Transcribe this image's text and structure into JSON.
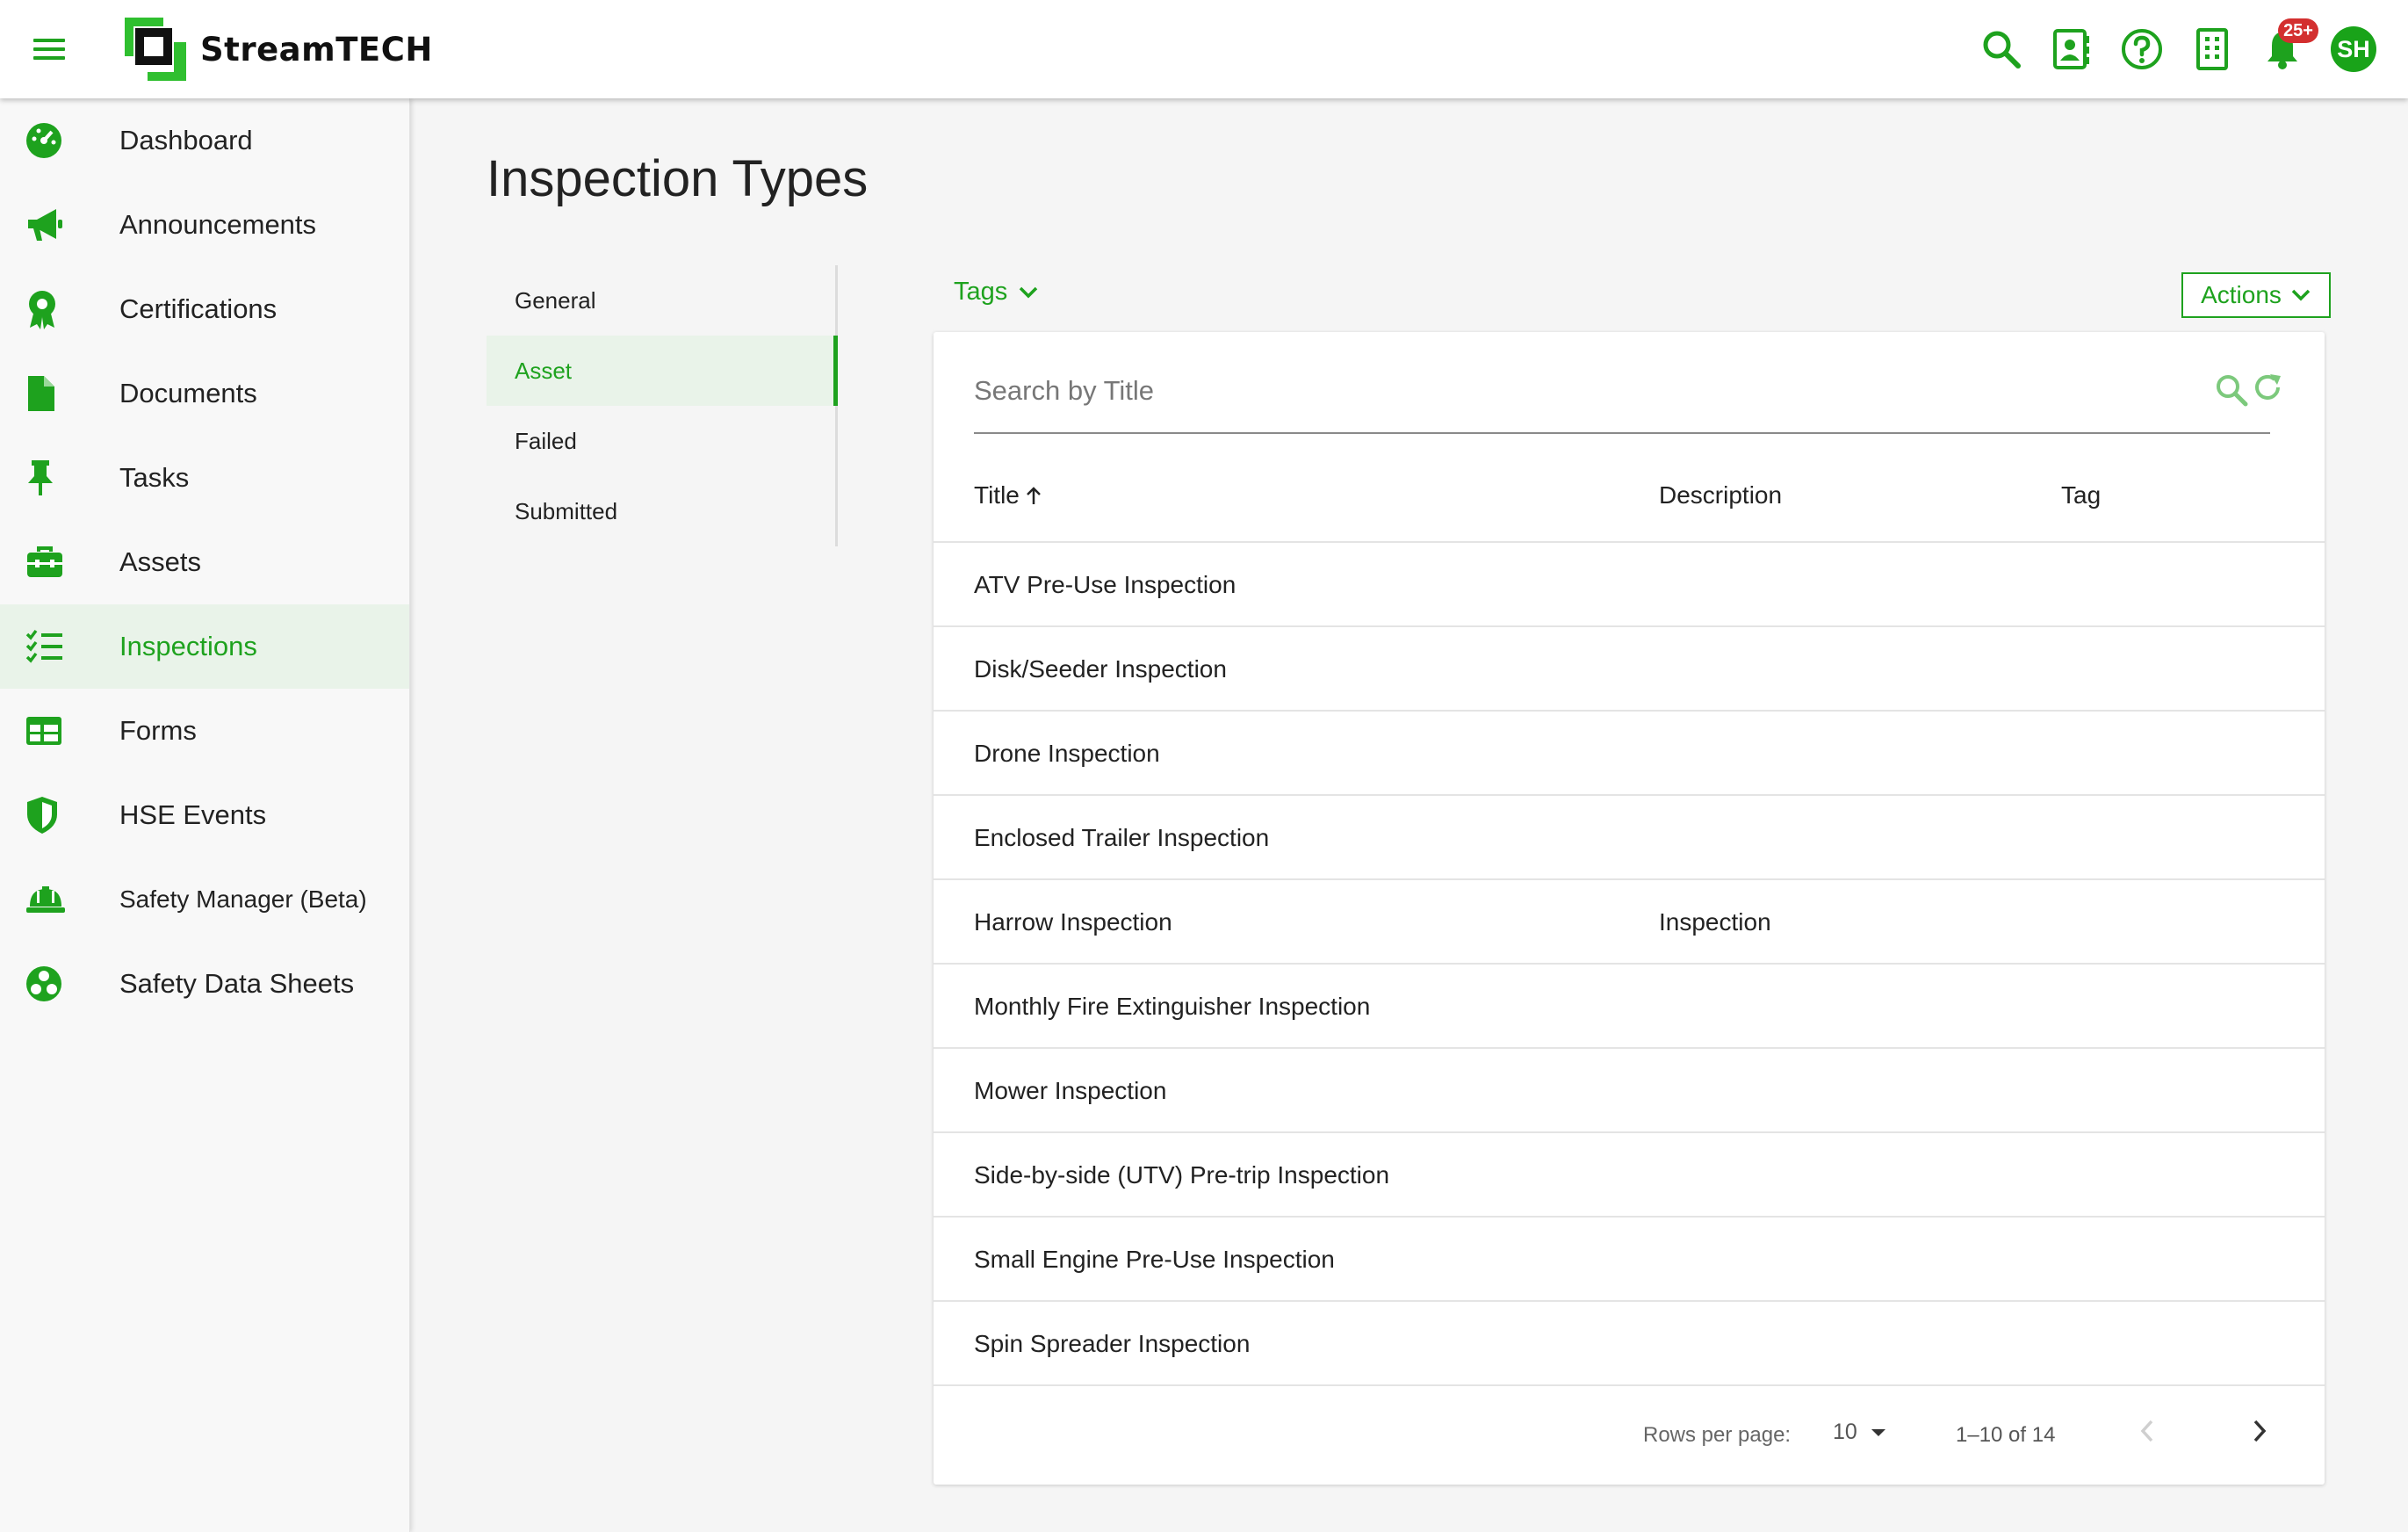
{
  "app": {
    "brand": "StreamTECH",
    "accent": "#1ea21e",
    "avatar_initials": "SH",
    "notification_badge": "25+"
  },
  "topbar_icons": [
    "search-icon",
    "contact-card-icon",
    "help-icon",
    "building-icon",
    "bell-icon"
  ],
  "sidebar": {
    "items": [
      {
        "label": "Dashboard",
        "icon": "dashboard-gauge-icon"
      },
      {
        "label": "Announcements",
        "icon": "megaphone-icon"
      },
      {
        "label": "Certifications",
        "icon": "award-ribbon-icon"
      },
      {
        "label": "Documents",
        "icon": "document-icon"
      },
      {
        "label": "Tasks",
        "icon": "pin-icon"
      },
      {
        "label": "Assets",
        "icon": "toolbox-icon"
      },
      {
        "label": "Inspections",
        "icon": "checklist-icon",
        "active": true
      },
      {
        "label": "Forms",
        "icon": "table-icon"
      },
      {
        "label": "HSE Events",
        "icon": "shield-icon"
      },
      {
        "label": "Safety Manager (Beta)",
        "icon": "hardhat-icon"
      },
      {
        "label": "Safety Data Sheets",
        "icon": "biohazard-icon"
      }
    ]
  },
  "page": {
    "title": "Inspection Types"
  },
  "subnav": {
    "items": [
      {
        "label": "General"
      },
      {
        "label": "Asset",
        "active": true
      },
      {
        "label": "Failed"
      },
      {
        "label": "Submitted"
      }
    ]
  },
  "toolbar": {
    "tags_label": "Tags",
    "actions_label": "Actions"
  },
  "search": {
    "placeholder": "Search by Title",
    "value": ""
  },
  "table": {
    "columns": [
      "Title",
      "Description",
      "Tag"
    ],
    "sort": {
      "column": "Title",
      "direction": "ascending"
    },
    "rows": [
      {
        "title": "ATV Pre-Use Inspection",
        "description": "",
        "tag": ""
      },
      {
        "title": "Disk/Seeder Inspection",
        "description": "",
        "tag": ""
      },
      {
        "title": "Drone Inspection",
        "description": "",
        "tag": ""
      },
      {
        "title": "Enclosed Trailer Inspection",
        "description": "",
        "tag": ""
      },
      {
        "title": "Harrow Inspection",
        "description": "Inspection",
        "tag": ""
      },
      {
        "title": "Monthly Fire Extinguisher Inspection",
        "description": "",
        "tag": ""
      },
      {
        "title": "Mower Inspection",
        "description": "",
        "tag": ""
      },
      {
        "title": "Side-by-side (UTV) Pre-trip Inspection",
        "description": "",
        "tag": ""
      },
      {
        "title": "Small Engine Pre-Use Inspection",
        "description": "",
        "tag": ""
      },
      {
        "title": "Spin Spreader Inspection",
        "description": "",
        "tag": ""
      }
    ]
  },
  "pagination": {
    "rows_per_page_label": "Rows per page:",
    "rows_per_page": "10",
    "range": "1–10 of 14"
  }
}
